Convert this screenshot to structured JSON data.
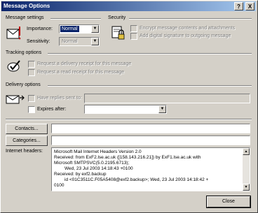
{
  "window": {
    "title": "Message Options",
    "help_btn": "?",
    "close_btn": "X"
  },
  "message_settings": {
    "heading": "Message settings",
    "importance_label": "Importance:",
    "importance_value": "Normal",
    "sensitivity_label": "Sensitivity:",
    "sensitivity_value": "Normal"
  },
  "security": {
    "heading": "Security",
    "encrypt_label": "Encrypt message contents and attachments",
    "sign_label": "Add digital signature to outgoing message"
  },
  "tracking": {
    "heading": "Tracking options",
    "delivery_label": "Request a delivery receipt for this message",
    "read_label": "Request a read receipt for this message"
  },
  "delivery": {
    "heading": "Delivery options",
    "replies_label": "Have replies sent to:",
    "expires_label": "Expires after:"
  },
  "buttons": {
    "contacts": "Contacts...",
    "categories": "Categories...",
    "close": "Close"
  },
  "headers": {
    "label": "Internet headers:",
    "lines": [
      "Microsoft Mail Internet Headers Version 2.0",
      "Received: from ExF2.lse.ac.uk ([158.143.216.21]) by ExF1.lse.ac.uk with",
      "Microsoft SMTPSVC(5.0.2195.6713);",
      "Wed, 23 Jul 2003 14:18:43 +0100",
      "Received: by exf2.backup",
      "id <01C3511C.F05A5408@exf2.backup>; Wed, 23 Jul 2003 14:18:42 +",
      "0100"
    ]
  }
}
